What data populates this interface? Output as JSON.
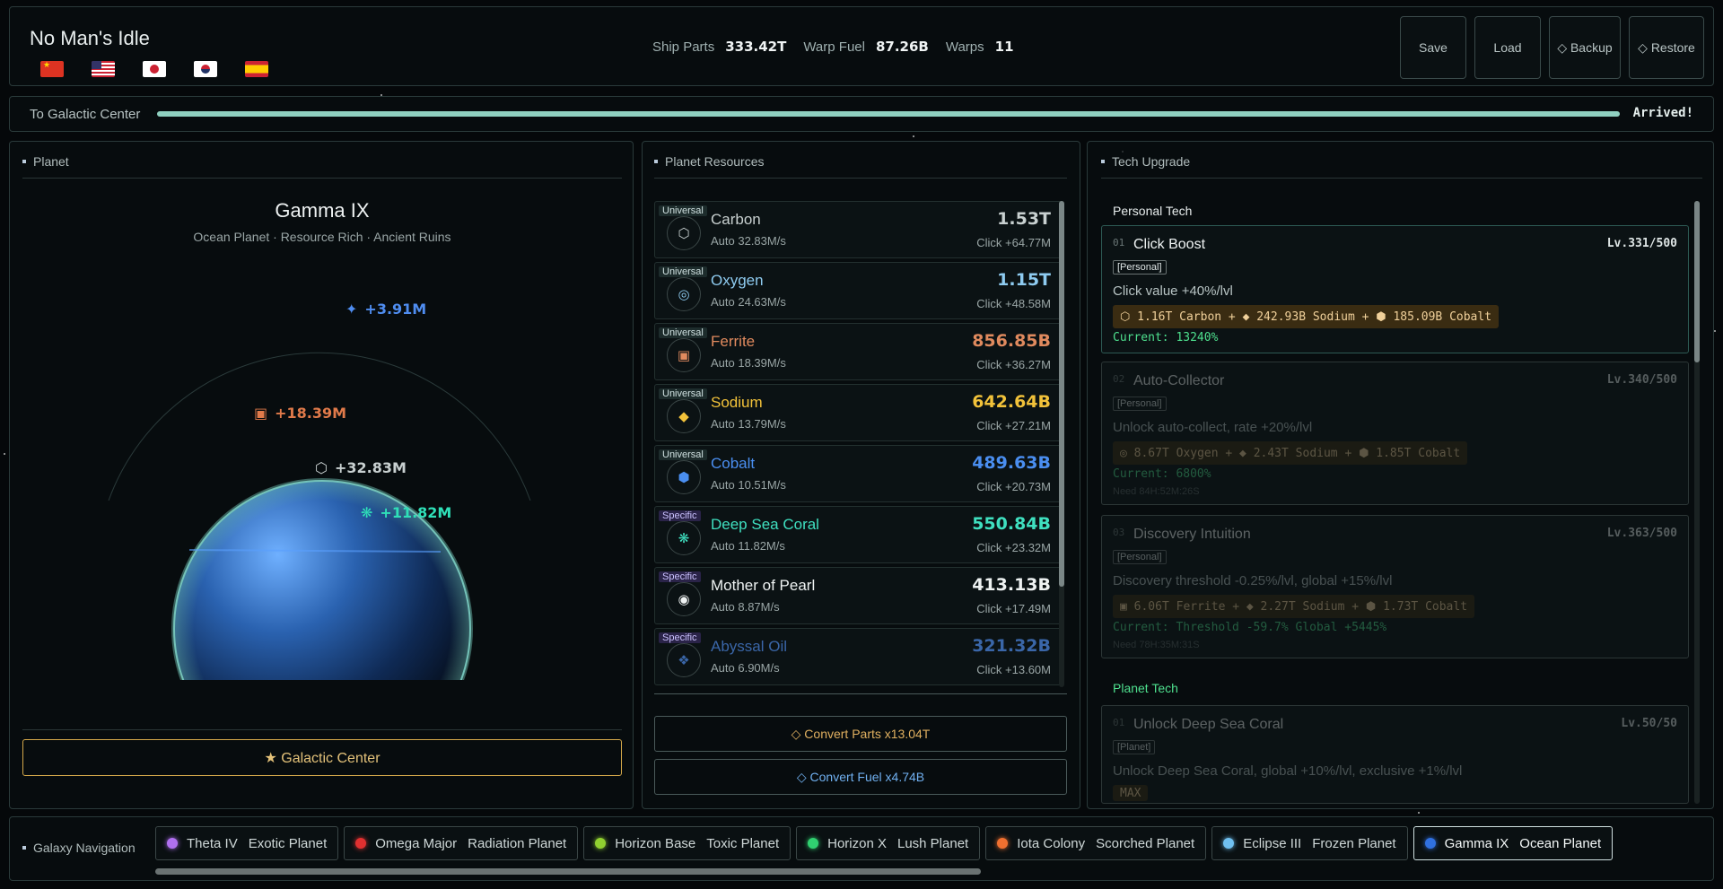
{
  "header": {
    "title": "No Man's Idle",
    "flags": [
      "flag-cn",
      "flag-us",
      "flag-jp",
      "flag-kr",
      "flag-es"
    ],
    "stats": [
      {
        "label": "Ship Parts",
        "value": "333.42T"
      },
      {
        "label": "Warp Fuel",
        "value": "87.26B"
      },
      {
        "label": "Warps",
        "value": "11"
      }
    ],
    "buttons": {
      "save": "Save",
      "load": "Load",
      "backup": "◇ Backup",
      "restore": "◇ Restore"
    }
  },
  "progress": {
    "label": "To Galactic Center",
    "status": "Arrived!",
    "percent": 100
  },
  "planet": {
    "section_title": "Planet",
    "name": "Gamma IX",
    "subtitle": "Ocean Planet · Resource Rich · Ancient Ruins",
    "floaters": [
      {
        "icon": "✦",
        "text": "+3.91M",
        "color": "#4f8df0"
      },
      {
        "icon": "▣",
        "text": "+18.39M",
        "color": "#e07a4a"
      },
      {
        "icon": "⬡",
        "text": "+32.83M",
        "color": "#c8d0d0"
      },
      {
        "icon": "❋",
        "text": "+11.82M",
        "color": "#2fe0b8"
      }
    ],
    "galactic_button": "★ Galactic Center"
  },
  "resources": {
    "section_title": "Planet Resources",
    "items": [
      {
        "tag": "Universal",
        "tag_type": "universal",
        "icon": "⬡",
        "name": "Carbon",
        "auto": "Auto 32.83M/s",
        "amount": "1.53T",
        "click": "Click +64.77M",
        "color": "#c8d0d0"
      },
      {
        "tag": "Universal",
        "tag_type": "universal",
        "icon": "◎",
        "name": "Oxygen",
        "auto": "Auto 24.63M/s",
        "amount": "1.15T",
        "click": "Click +48.58M",
        "color": "#8ecbf0"
      },
      {
        "tag": "Universal",
        "tag_type": "universal",
        "icon": "▣",
        "name": "Ferrite",
        "auto": "Auto 18.39M/s",
        "amount": "856.85B",
        "click": "Click +36.27M",
        "color": "#e08a5e"
      },
      {
        "tag": "Universal",
        "tag_type": "universal",
        "icon": "◆",
        "name": "Sodium",
        "auto": "Auto 13.79M/s",
        "amount": "642.64B",
        "click": "Click +27.21M",
        "color": "#f2c23a"
      },
      {
        "tag": "Universal",
        "tag_type": "universal",
        "icon": "⬢",
        "name": "Cobalt",
        "auto": "Auto 10.51M/s",
        "amount": "489.63B",
        "click": "Click +20.73M",
        "color": "#4a8ef0"
      },
      {
        "tag": "Specific",
        "tag_type": "specific",
        "icon": "❋",
        "name": "Deep Sea Coral",
        "auto": "Auto 11.82M/s",
        "amount": "550.84B",
        "click": "Click +23.32M",
        "color": "#3fe0c0"
      },
      {
        "tag": "Specific",
        "tag_type": "specific",
        "icon": "◉",
        "name": "Mother of Pearl",
        "auto": "Auto 8.87M/s",
        "amount": "413.13B",
        "click": "Click +17.49M",
        "color": "#eef2f2"
      },
      {
        "tag": "Specific",
        "tag_type": "specific",
        "icon": "❖",
        "name": "Abyssal Oil",
        "auto": "Auto 6.90M/s",
        "amount": "321.32B",
        "click": "Click +13.60M",
        "color": "#3a66a8"
      }
    ],
    "convert_parts": "◇ Convert Parts x13.04T",
    "convert_fuel": "◇ Convert Fuel x4.74B"
  },
  "tech": {
    "section_title": "Tech Upgrade",
    "personal_title": "Personal Tech",
    "planet_title": "Planet Tech",
    "personal": [
      {
        "num": "01",
        "name": "Click Boost",
        "level": "Lv.331/500",
        "tag": "[Personal]",
        "desc": "Click value +40%/lvl",
        "cost": "⬡ 1.16T Carbon + ◆ 242.93B Sodium + ⬢ 185.09B Cobalt",
        "current": "Current: 13240%",
        "need": ""
      },
      {
        "num": "02",
        "name": "Auto-Collector",
        "level": "Lv.340/500",
        "tag": "[Personal]",
        "desc": "Unlock auto-collect, rate +20%/lvl",
        "cost": "◎ 8.67T Oxygen + ◆ 2.43T Sodium + ⬢ 1.85T Cobalt",
        "current": "Current: 6800%",
        "need": "Need 84H:52M:26S"
      },
      {
        "num": "03",
        "name": "Discovery Intuition",
        "level": "Lv.363/500",
        "tag": "[Personal]",
        "desc": "Discovery threshold -0.25%/lvl, global +15%/lvl",
        "cost": "▣ 6.06T Ferrite + ◆ 2.27T Sodium + ⬢ 1.73T Cobalt",
        "current": "Current: Threshold -59.7% Global +5445%",
        "need": "Need 78H:35M:31S"
      }
    ],
    "planet": [
      {
        "num": "01",
        "name": "Unlock Deep Sea Coral",
        "level": "Lv.50/50",
        "tag": "[Planet]",
        "desc": "Unlock Deep Sea Coral, global +10%/lvl, exclusive +1%/lvl",
        "max": "MAX"
      }
    ]
  },
  "galaxy": {
    "label": "Galaxy Navigation",
    "tabs": [
      {
        "name": "Theta IV",
        "type": "Exotic Planet",
        "color": "#b070f0"
      },
      {
        "name": "Omega Major",
        "type": "Radiation Planet",
        "color": "#e03030"
      },
      {
        "name": "Horizon Base",
        "type": "Toxic Planet",
        "color": "#90d030"
      },
      {
        "name": "Horizon X",
        "type": "Lush Planet",
        "color": "#30d070"
      },
      {
        "name": "Iota Colony",
        "type": "Scorched Planet",
        "color": "#f07030"
      },
      {
        "name": "Eclipse III",
        "type": "Frozen Planet",
        "color": "#70c0f0"
      },
      {
        "name": "Gamma IX",
        "type": "Ocean Planet",
        "color": "#3070e0"
      }
    ]
  },
  "colors": {
    "accent": "#8fd0c0",
    "gold": "#d4a84a",
    "green": "#4ee08e"
  }
}
